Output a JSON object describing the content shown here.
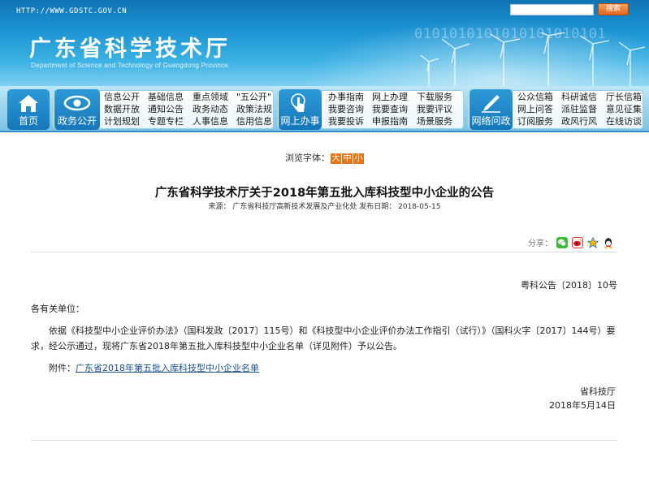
{
  "header": {
    "url": "HTTP://WWW.GDSTC.GOV.CN",
    "title": "广东省科学技术厅",
    "subtitle": "Department of Science and Technology of Guangdong Province",
    "binary": "0101010101010101010101",
    "search_placeholder": "",
    "search_button": "搜索"
  },
  "nav": {
    "home": "首页",
    "gov": {
      "label": "政务公开",
      "links": [
        [
          "信息公开",
          "基础信息",
          "重点领域",
          "\"五公开\""
        ],
        [
          "数据开放",
          "通知公告",
          "政务动态",
          "政策法规"
        ],
        [
          "计划规划",
          "专题专栏",
          "人事信息",
          "信用信息"
        ]
      ]
    },
    "online": {
      "label": "网上办事",
      "links": [
        [
          "办事指南",
          "网上办理",
          "下载服务"
        ],
        [
          "我要咨询",
          "我要查询",
          "我要评议"
        ],
        [
          "我要投诉",
          "申报指南",
          "场景服务"
        ]
      ]
    },
    "ask": {
      "label": "网络问政",
      "links": [
        [
          "公众信箱",
          "科研诚信",
          "厅长信箱"
        ],
        [
          "网上问答",
          "派驻监督",
          "意见征集"
        ],
        [
          "订阅服务",
          "政风行风",
          "在线访谈"
        ]
      ]
    }
  },
  "article": {
    "font_label": "浏览字体：",
    "font_sizes": [
      "大",
      "中",
      "小"
    ],
    "title": "广东省科学技术厅关于2018年第五批入库科技型中小企业的公告",
    "meta": "来源：  广东省科技厅高新技术发展及产业化处    发布日期：  2018-05-15",
    "share_label": "分享：",
    "doc_number": "粤科公告〔2018〕10号",
    "addressee": "各有关单位：",
    "body": "依据《科技型中小企业评价办法》（国科发政〔2017〕115号）和《科技型中小企业评价办法工作指引（试行）》（国科火字〔2017〕144号）要求，经公示通过，现将广东省2018年第五批入库科技型中小企业名单（详见附件）予以公告。",
    "attachment_label": "附件：",
    "attachment_link": "广东省2018年第五批入库科技型中小企业名单",
    "signer": "省科技厅",
    "sign_date": "2018年5月14日"
  },
  "colors": {
    "header_blue": "#1c93d2",
    "nav_block": "#1677b9",
    "font_size_button": "#e8751a",
    "link": "#1b4f8a"
  },
  "icons": [
    "home-icon",
    "eye-icon",
    "pointer-hand-icon",
    "pen-icon",
    "wechat-icon",
    "weibo-icon",
    "qzone-icon",
    "qq-icon"
  ]
}
